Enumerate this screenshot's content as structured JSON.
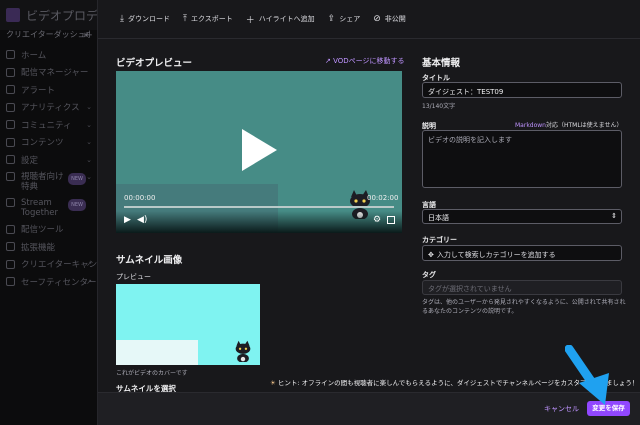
{
  "background": {
    "app_title": "ビデオプロデュー…",
    "subheading": "クリエイターダッシュボー…",
    "sidebar": [
      {
        "label": "ホーム",
        "chevron": false
      },
      {
        "label": "配信マネージャー",
        "chevron": false
      },
      {
        "label": "アラート",
        "chevron": false
      },
      {
        "label": "アナリティクス",
        "chevron": true
      },
      {
        "label": "コミュニティ",
        "chevron": true
      },
      {
        "label": "コンテンツ",
        "chevron": true
      },
      {
        "label": "設定",
        "chevron": true
      },
      {
        "label": "視聴者向け\n特典",
        "chevron": true,
        "badge": "NEW"
      },
      {
        "label": "Stream\nTogether",
        "chevron": false,
        "badge": "NEW"
      },
      {
        "label": "配信ツール",
        "chevron": false
      },
      {
        "label": "拡張機能",
        "chevron": false
      },
      {
        "label": "クリエイターキャンプ",
        "chevron": false,
        "external": true
      },
      {
        "label": "セーフティセンター",
        "chevron": false,
        "external": true
      }
    ]
  },
  "toolbar": {
    "download": "ダウンロード",
    "export": "エクスポート",
    "add_to_highlight": "ハイライトへ追加",
    "share": "シェア",
    "private": "非公開"
  },
  "preview": {
    "title": "ビデオプレビュー",
    "vod_link": "VODページに移動する",
    "current_time": "00:00:00",
    "duration": "00:02:00",
    "progress": 0.0
  },
  "thumbnail": {
    "title": "サムネイル画像",
    "preview_label": "プレビュー",
    "caption": "これがビデオのカバーです",
    "select_label": "サムネイルを選択"
  },
  "basic_info": {
    "title": "基本情報",
    "title_label": "タイトル",
    "title_value": "ダイジェスト：TEST09",
    "title_count": "13/140文字",
    "desc_label": "説明",
    "desc_markdown": "Markdown",
    "desc_markdown_note": "対応（HTMLは使えません）",
    "desc_placeholder": "ビデオの説明を記入します",
    "language_label": "言語",
    "language_value": "日本語",
    "category_label": "カテゴリー",
    "category_placeholder": "入力して検索しカテゴリーを追加する",
    "tag_label": "タグ",
    "tag_placeholder": "タグが選択されていません",
    "tag_hint": "タグは、他のユーザーから発見されやすくなるように、公開されて共有されるあなたのコンテンツの説明です。"
  },
  "footer": {
    "hint": "ヒント: オフラインの間も視聴者に楽しんでもらえるように、ダイジェストでチャンネルページをカスタマイズしましょう！",
    "cancel": "キャンセル",
    "save": "変更を保存"
  },
  "colors": {
    "accent": "#9147ff",
    "link": "#bf94ff",
    "pointer_arrow": "#1fa1f0"
  },
  "icons": {
    "download": "download-icon",
    "export": "upload-icon",
    "add": "plus-icon",
    "share": "share-icon",
    "private": "eye-off-icon"
  }
}
